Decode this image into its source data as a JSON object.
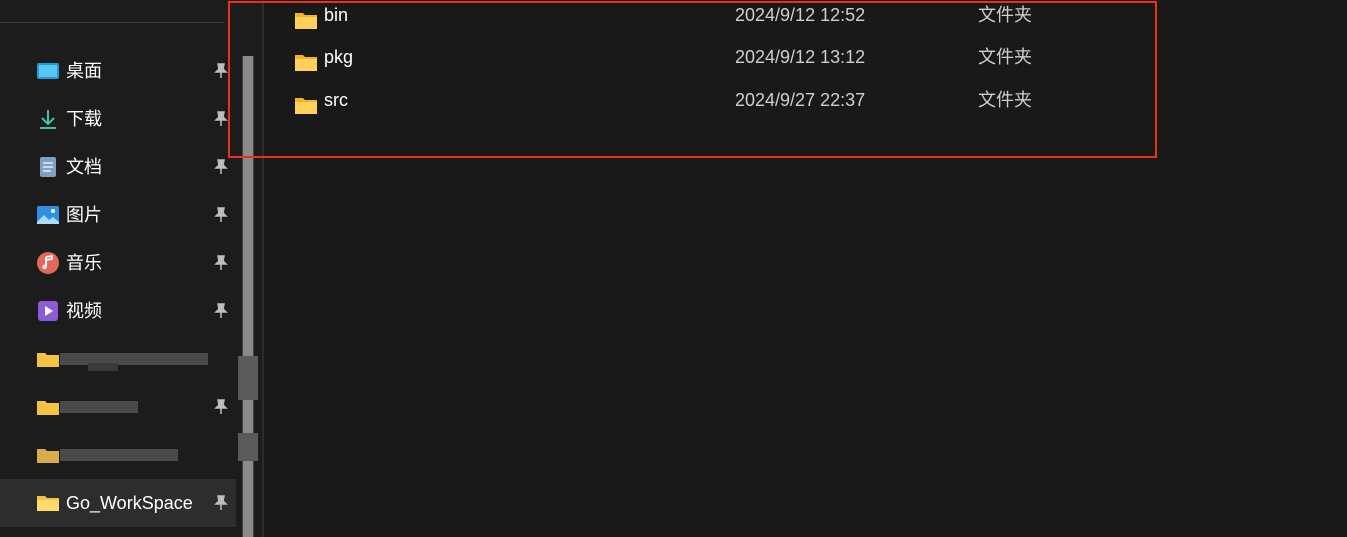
{
  "sidebar": {
    "items": [
      {
        "label": "桌面",
        "icon": "desktop-icon"
      },
      {
        "label": "下载",
        "icon": "download-icon"
      },
      {
        "label": "文档",
        "icon": "document-icon"
      },
      {
        "label": "图片",
        "icon": "pictures-icon"
      },
      {
        "label": "音乐",
        "icon": "music-icon"
      },
      {
        "label": "视频",
        "icon": "video-icon"
      },
      {
        "label": "",
        "icon": "folder-icon",
        "redacted": true
      },
      {
        "label": "",
        "icon": "folder-icon",
        "redacted": true
      },
      {
        "label": "",
        "icon": "folder-icon",
        "redacted": true
      },
      {
        "label": "Go_WorkSpace",
        "icon": "folder-icon",
        "selected": true
      }
    ]
  },
  "files": [
    {
      "name": "bin",
      "date": "2024/9/12 12:52",
      "type": "文件夹"
    },
    {
      "name": "pkg",
      "date": "2024/9/12 13:12",
      "type": "文件夹"
    },
    {
      "name": "src",
      "date": "2024/9/27 22:37",
      "type": "文件夹"
    }
  ],
  "colors": {
    "background": "#191919",
    "highlight": "#e8321f",
    "folder": "#f5c242",
    "selected": "#2d2d2d"
  }
}
